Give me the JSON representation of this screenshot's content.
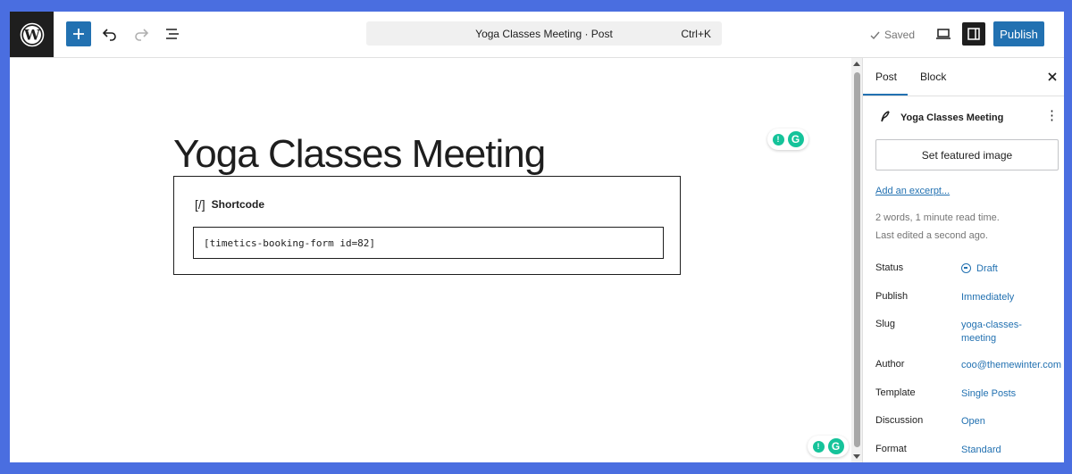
{
  "toolbar": {
    "add_label": "+",
    "command_title": "Yoga Classes Meeting · Post",
    "command_shortcut": "Ctrl+K",
    "saved_label": "Saved",
    "publish_label": "Publish"
  },
  "editor": {
    "title": "Yoga Classes Meeting",
    "block_label": "Shortcode",
    "block_glyph": "[/]",
    "shortcode_value": "[timetics-booking-form id=82]"
  },
  "sidebar": {
    "tabs": [
      {
        "label": "Post"
      },
      {
        "label": "Block"
      }
    ],
    "post_title": "Yoga Classes Meeting",
    "featured_image_label": "Set featured image",
    "excerpt_link": "Add an excerpt...",
    "word_count": "2 words, 1 minute read time.",
    "last_edited": "Last edited a second ago.",
    "rows": [
      {
        "key": "Status",
        "value": "Draft"
      },
      {
        "key": "Publish",
        "value": "Immediately"
      },
      {
        "key": "Slug",
        "value": "yoga-classes-meeting"
      },
      {
        "key": "Author",
        "value": "coo@themewinter.com"
      },
      {
        "key": "Template",
        "value": "Single Posts"
      },
      {
        "key": "Discussion",
        "value": "Open"
      },
      {
        "key": "Format",
        "value": "Standard"
      }
    ]
  },
  "colors": {
    "accent": "#2271b1",
    "background": "#4a6ee0",
    "grammarly": "#15c39a"
  }
}
